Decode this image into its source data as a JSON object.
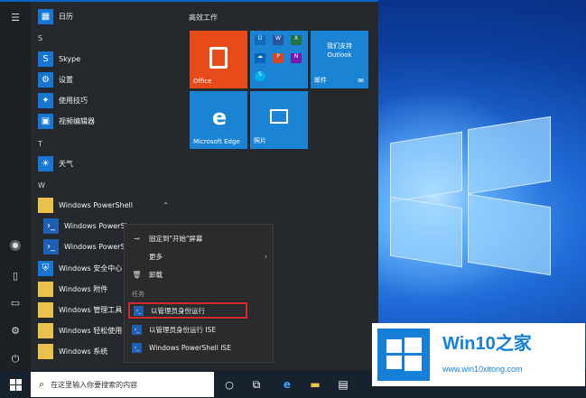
{
  "start_menu": {
    "letters": {
      "s": "S",
      "t": "T",
      "w": "W"
    },
    "apps": {
      "calendar": "日历",
      "skype": "Skype",
      "settings": "设置",
      "tips": "使用技巧",
      "video_editor": "视频编辑器",
      "weather": "天气",
      "powershell_folder": "Windows PowerShell",
      "powershell_1": "Windows PowerSh",
      "powershell_2": "Windows PowerSh",
      "security": "Windows 安全中心",
      "accessories": "Windows 附件",
      "admin_tools": "Windows 管理工具",
      "ease_access": "Windows 轻松使用",
      "system": "Windows 系统"
    },
    "tiles": {
      "group_title": "高效工作",
      "office": "Office",
      "mail_title": "我们支持 Outlook",
      "mail": "邮件",
      "edge": "Microsoft Edge",
      "photos": "照片"
    }
  },
  "context_menu": {
    "pin": "固定到\"开始\"屏幕",
    "more": "更多",
    "uninstall": "卸载",
    "tasks_header": "任务",
    "run_as_admin": "以管理员身份运行",
    "run_ise_admin": "以管理员身份运行 ISE",
    "ise": "Windows PowerShell ISE"
  },
  "taskbar": {
    "search_placeholder": "在这里输入你要搜索的内容"
  },
  "watermark": {
    "title": "Win10之家",
    "url": "www.win10xitong.com"
  },
  "colors": {
    "accent": "#0a64c8",
    "office_tile": "#e74b1a",
    "tile_blue": "#1a83d4",
    "highlight_border": "#d22b2b"
  }
}
